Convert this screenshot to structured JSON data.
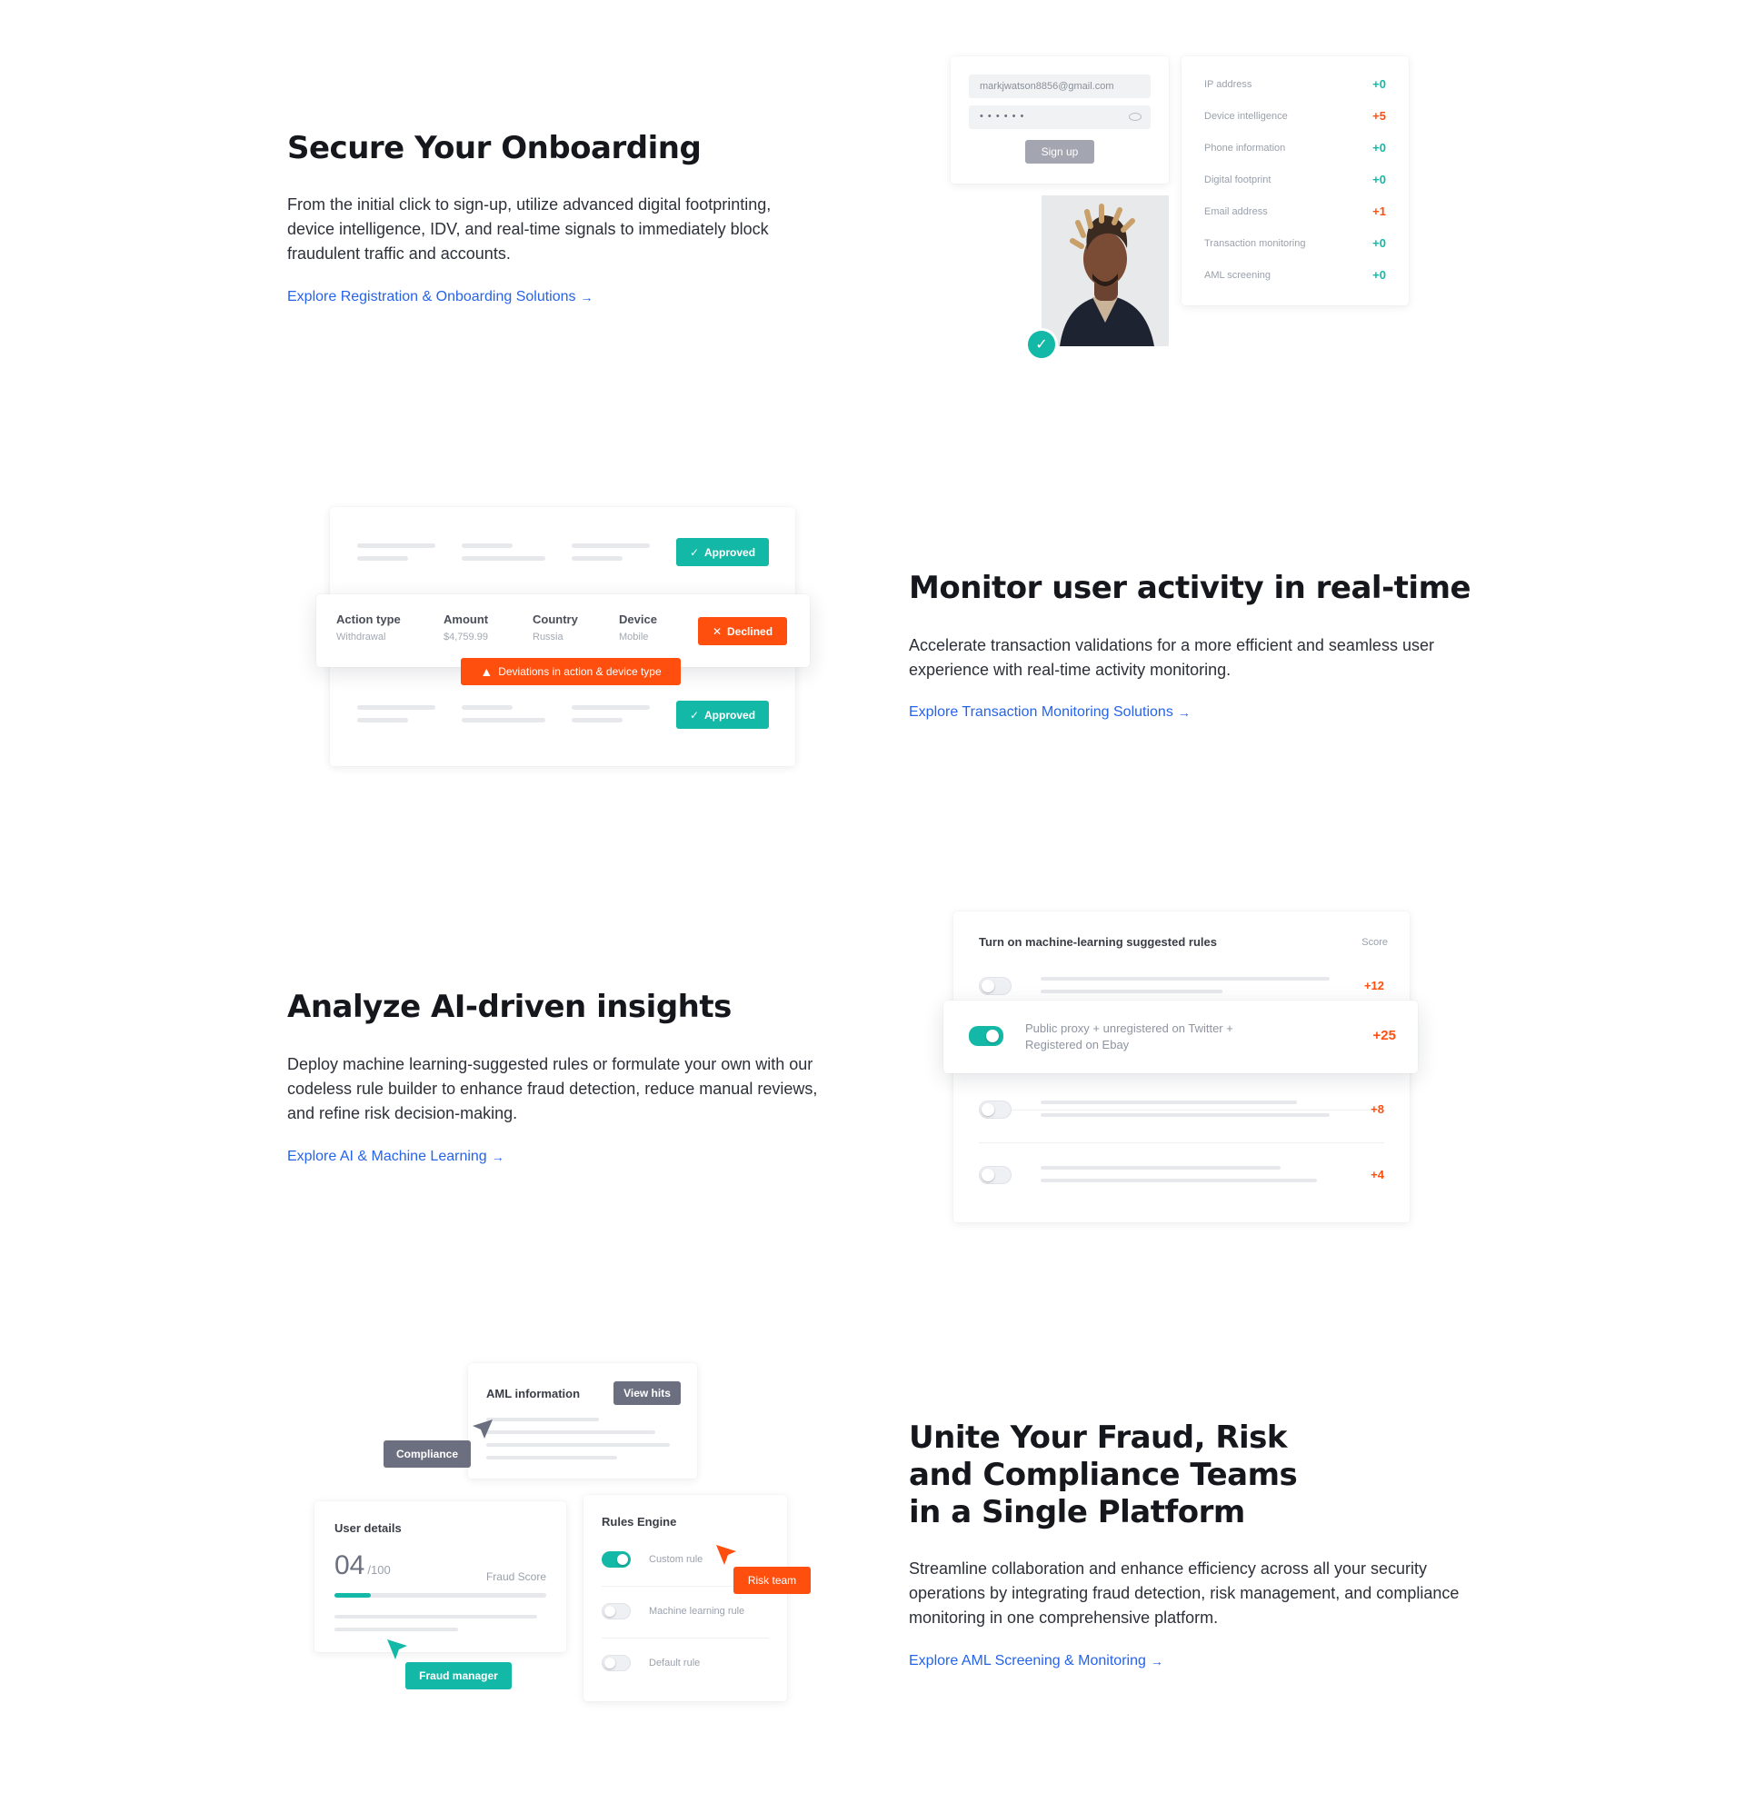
{
  "sections": {
    "onboarding": {
      "title": "Secure Your Onboarding",
      "description": "From the initial click to sign-up, utilize advanced digital footprinting, device intelligence, IDV, and real-time signals to immediately block fraudulent traffic and accounts.",
      "link": "Explore Registration & Onboarding Solutions",
      "signup_form": {
        "email_value": "markjwatson8856@gmail.com",
        "password_mask": "• • • • • •",
        "button_label": "Sign up"
      },
      "signals": [
        {
          "label": "IP address",
          "score": "+0",
          "color": "#14b8a6"
        },
        {
          "label": "Device intelligence",
          "score": "+5",
          "color": "#ff4f0f"
        },
        {
          "label": "Phone information",
          "score": "+0",
          "color": "#14b8a6"
        },
        {
          "label": "Digital footprint",
          "score": "+0",
          "color": "#14b8a6"
        },
        {
          "label": "Email address",
          "score": "+1",
          "color": "#ff4f0f"
        },
        {
          "label": "Transaction monitoring",
          "score": "+0",
          "color": "#14b8a6"
        },
        {
          "label": "AML screening",
          "score": "+0",
          "color": "#14b8a6"
        }
      ]
    },
    "monitoring": {
      "title": "Monitor user activity in real-time",
      "description": "Accelerate transaction validations for a more efficient and seamless user experience with real-time activity monitoring.",
      "link": "Explore Transaction Monitoring Solutions",
      "approved_label": "Approved",
      "declined_label": "Declined",
      "warning": "Deviations in action & device type",
      "columns": [
        {
          "header": "Action type",
          "value": "Withdrawal"
        },
        {
          "header": "Amount",
          "value": "$4,759.99"
        },
        {
          "header": "Country",
          "value": "Russia"
        },
        {
          "header": "Device",
          "value": "Mobile"
        }
      ]
    },
    "insights": {
      "title": "Analyze AI-driven insights",
      "description": "Deploy machine learning-suggested rules or formulate your own with our codeless rule builder to enhance fraud detection, reduce manual reviews, and refine risk decision-making.",
      "link": "Explore AI & Machine Learning",
      "card_title": "Turn on machine-learning suggested rules",
      "score_header": "Score",
      "rules": [
        {
          "text": "",
          "score": "+12",
          "on": false
        },
        {
          "text": "Public proxy + unregistered on Twitter + Registered on Ebay",
          "score": "+25",
          "on": true
        },
        {
          "text": "",
          "score": "+8",
          "on": false
        },
        {
          "text": "",
          "score": "+4",
          "on": false
        }
      ]
    },
    "unite": {
      "title": "Unite Your Fraud, Risk and Compliance Teams in a Single Platform",
      "description": "Streamline collaboration and enhance efficiency across all your security operations by integrating fraud detection, risk management, and compliance monitoring in one comprehensive platform.",
      "link": "Explore AML Screening & Monitoring",
      "aml_title": "AML information",
      "view_hits": "View hits",
      "compliance": "Compliance",
      "user_details": "User details",
      "fraud_score": {
        "value": "04",
        "max": "/100",
        "label": "Fraud Score",
        "fill": 0.04
      },
      "fraud_manager": "Fraud manager",
      "rules_engine": "Rules Engine",
      "risk_team": "Risk team",
      "engine_rules": [
        {
          "label": "Custom rule",
          "on": true
        },
        {
          "label": "Machine learning rule",
          "on": false
        },
        {
          "label": "Default rule",
          "on": false
        }
      ]
    }
  },
  "colors": {
    "teal": "#14b8a6",
    "orange": "#ff4f0f",
    "link": "#2563eb",
    "slate": "#6b6f7f"
  },
  "icons": [
    "arrow-right-icon",
    "check-icon",
    "close-icon",
    "warning-icon",
    "eye-icon",
    "cursor-icon",
    "check-badge-icon"
  ]
}
